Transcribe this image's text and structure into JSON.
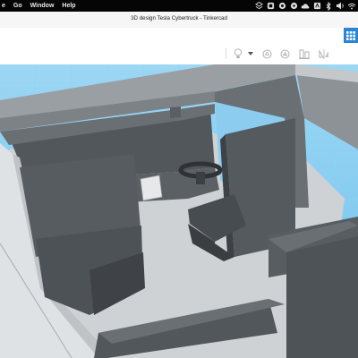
{
  "menubar": {
    "items": [
      "e",
      "Go",
      "Window",
      "Help"
    ],
    "status_icons": [
      "dropbox-icon",
      "system-icon",
      "record-icon",
      "user-icon",
      "cloud-icon",
      "adobe-icon",
      "bluetooth-icon",
      "volume-icon",
      "wifi-icon"
    ]
  },
  "window": {
    "title": "3D design Tesla Cybertruck - Tinkercad"
  },
  "toolbar": {
    "icons": [
      "light-bulb-icon",
      "dropdown-arrow-icon",
      "shape-outline-icon",
      "solid-shape-icon",
      "align-icon",
      "mirror-icon"
    ]
  },
  "colors": {
    "grid_background": "#7ec9ef",
    "model_dark": "#4e5357",
    "model_floor": "#cfd2d4",
    "accent": "#2b85d3"
  }
}
